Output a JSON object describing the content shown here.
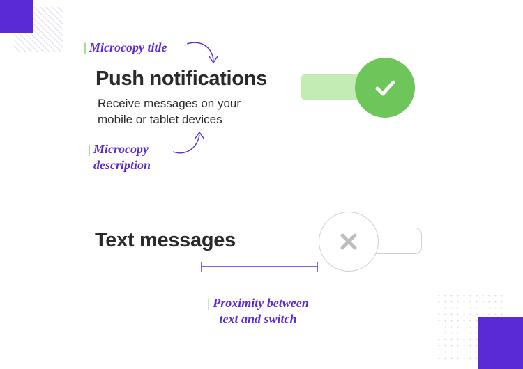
{
  "annotations": {
    "microcopy_title": "Microcopy title",
    "microcopy_description_l1": "Microcopy",
    "microcopy_description_l2": "description",
    "proximity_l1": "Proximity between",
    "proximity_l2": "text and switch"
  },
  "settings": {
    "push": {
      "title": "Push notifications",
      "description": "Receive messages on your mobile or tablet devices"
    },
    "text": {
      "title": "Text messages"
    }
  },
  "colors": {
    "accent_purple": "#5a2ad6",
    "accent_green": "#6ec55a",
    "track_on": "#c3ecb5",
    "off_stroke": "#cfcfcf"
  }
}
